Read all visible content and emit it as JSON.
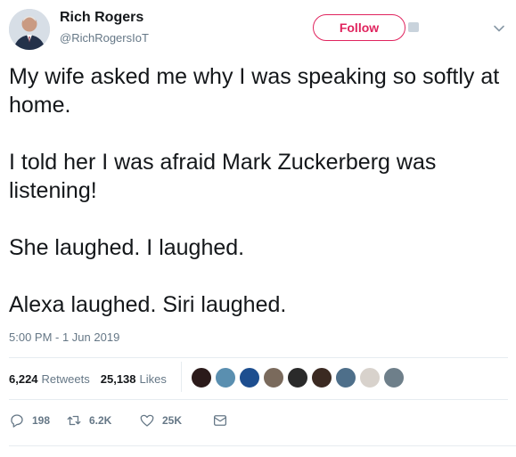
{
  "author": {
    "name": "Rich Rogers",
    "handle": "@RichRogersIoT"
  },
  "follow_button": {
    "label": "Follow"
  },
  "tweet": {
    "paragraphs": [
      "My wife asked me why I was speaking so softly at home.",
      "I told her I was afraid Mark Zuckerberg was listening!",
      "She laughed. I laughed.",
      "Alexa laughed. Siri laughed."
    ],
    "timestamp": "5:00 PM - 1 Jun 2019"
  },
  "stats": {
    "retweets_count": "6,224",
    "retweets_label": "Retweets",
    "likes_count": "25,138",
    "likes_label": "Likes"
  },
  "likers_colors": [
    "#2b1a1a",
    "#5a8fb0",
    "#1d4e8f",
    "#7a6a5c",
    "#2a2a2a",
    "#3b2a22",
    "#4e6f8a",
    "#d8d2cc",
    "#6e7f8a"
  ],
  "actions": {
    "reply_count": "198",
    "retweet_count": "6.2K",
    "like_count": "25K"
  },
  "colors": {
    "accent": "#e0245e",
    "secondary_text": "#657786",
    "primary_text": "#14171a"
  },
  "icons": [
    "caret-down-icon",
    "reply-icon",
    "retweet-icon",
    "like-icon",
    "message-icon"
  ]
}
